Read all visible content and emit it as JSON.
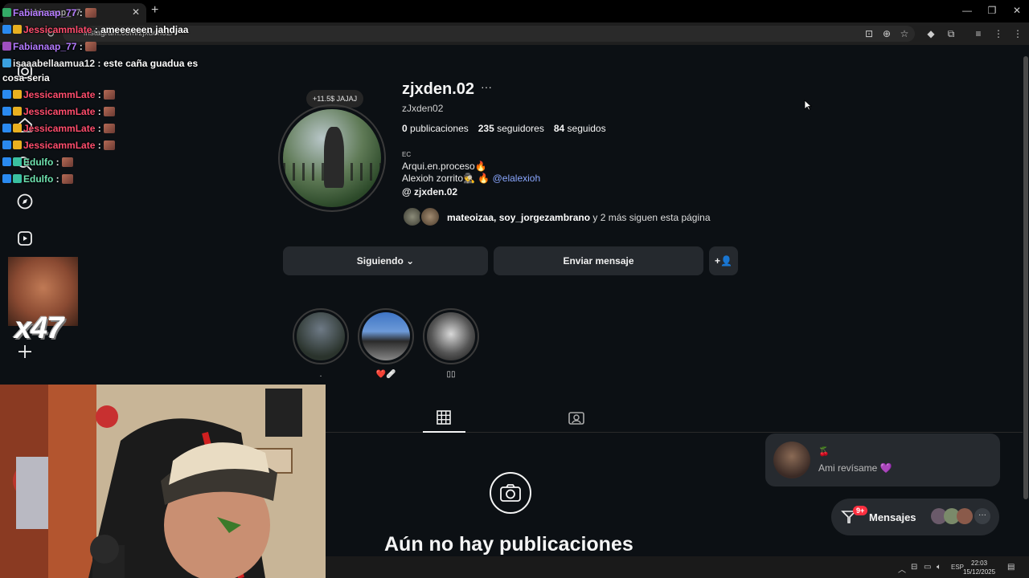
{
  "browser": {
    "tab_title": "Fabianaap_77",
    "url": "instagram.com/zjxden02/"
  },
  "profile": {
    "note": "+11.5$ JAJAJ",
    "username": "zjxden.02",
    "handle": "zJxden02",
    "stats": [
      {
        "value": "0",
        "label": "publicaciones"
      },
      {
        "value": "235",
        "label": "seguidores"
      },
      {
        "value": "84",
        "label": "seguidos"
      }
    ],
    "bio_small": "EC",
    "bio_line1": "Arqui.en.proceso🔥",
    "bio_line2_text": "Alexioh zorrito🕵️ 🔥",
    "bio_mention": "@elalexioh",
    "threads": "zjxden.02",
    "followed_by_names": "mateoizaa, soy_jorgezambrano",
    "followed_by_rest": " y 2 más siguen esta página"
  },
  "buttons": {
    "following": "Siguiendo",
    "message": "Enviar mensaje"
  },
  "highlights": [
    {
      "label": "."
    },
    {
      "label": "❤️🩹"
    },
    {
      "label": "▯▯"
    }
  ],
  "empty_state": {
    "title": "Aún no hay publicaciones"
  },
  "messages": {
    "preview_emoji": "🍒",
    "preview_text": "Ami revísame 💜",
    "dock_label": "Mensajes",
    "badge": "9+"
  },
  "taskbar": {
    "lang": "ESP",
    "time": "22:03",
    "date": "15/12/2025"
  },
  "chat": [
    {
      "user": "Fabianaap_77",
      "msg": "",
      "color": "#b57bff"
    },
    {
      "user": "Jessicammlate",
      "msg": " ameeeeeen jahdjaa",
      "color": "#ff4d6d"
    },
    {
      "user": "Fabianaap_77",
      "msg": "",
      "color": "#b57bff"
    },
    {
      "user": "isaaabellaamua12",
      "msg": " este caña guadua es",
      "color": "#eeeeee"
    },
    {
      "user": "",
      "msg": "cosa seria",
      "color": "#eeeeee"
    },
    {
      "user": "JessicammLate",
      "msg": "",
      "color": "#ff4d6d"
    },
    {
      "user": "JessicammLate",
      "msg": "",
      "color": "#ff4d6d"
    },
    {
      "user": "JessicammLate",
      "msg": "",
      "color": "#ff4d6d"
    },
    {
      "user": "JessicammLate",
      "msg": "",
      "color": "#ff4d6d"
    },
    {
      "user": "Edulfo",
      "msg": "",
      "color": "#6fe3b0"
    },
    {
      "user": "Edulfo",
      "msg": "",
      "color": "#6fe3b0"
    }
  ],
  "combo": "x47"
}
